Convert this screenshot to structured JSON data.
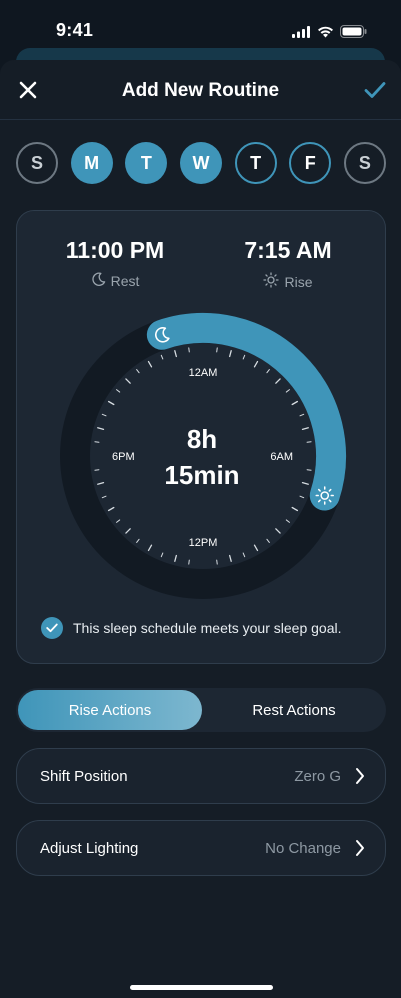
{
  "status_bar": {
    "time": "9:41"
  },
  "nav": {
    "title": "Add New Routine"
  },
  "days": [
    {
      "label": "S",
      "state": "weekend-off"
    },
    {
      "label": "M",
      "state": "on"
    },
    {
      "label": "T",
      "state": "on"
    },
    {
      "label": "W",
      "state": "on"
    },
    {
      "label": "T",
      "state": "off"
    },
    {
      "label": "F",
      "state": "off"
    },
    {
      "label": "S",
      "state": "weekend-off"
    }
  ],
  "schedule": {
    "rest": {
      "time": "11:00 PM",
      "label": "Rest",
      "icon": "moon-icon"
    },
    "rise": {
      "time": "7:15 AM",
      "label": "Rise",
      "icon": "sun-icon"
    },
    "duration_hours": "8h",
    "duration_minutes": "15min",
    "dial_labels": {
      "top": "12AM",
      "right": "6AM",
      "bottom": "12PM",
      "left": "6PM"
    },
    "goal_message": "This sleep schedule meets your sleep goal."
  },
  "tabs": [
    {
      "label": "Rise Actions",
      "active": true
    },
    {
      "label": "Rest Actions",
      "active": false
    }
  ],
  "actions": [
    {
      "label": "Shift Position",
      "value": "Zero G"
    },
    {
      "label": "Adjust Lighting",
      "value": "No Change"
    }
  ],
  "colors": {
    "accent": "#3f95b9",
    "background": "#0f1720",
    "card": "#1d2733",
    "muted_text": "#9aa4ad"
  }
}
